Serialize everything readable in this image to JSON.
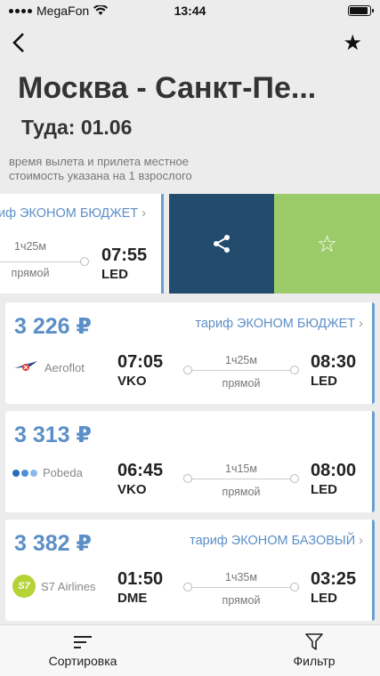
{
  "status_bar": {
    "carrier": "MegaFon",
    "time": "13:44",
    "battery_level": 0.9
  },
  "header": {
    "title": "Москва - Санкт-Пе...",
    "subtitle": "Туда: 01.06",
    "note_line1": "время вылета и прилета местное",
    "note_line2": "стоимость указана на 1 взрослого"
  },
  "swiped_card": {
    "tariff": "иф ЭКОНОМ БЮДЖЕТ",
    "duration": "1ч25м",
    "direct": "прямой",
    "arr_time": "07:55",
    "arr_code": "LED",
    "actions": {
      "share_icon": "share-icon",
      "favorite_icon": "star-outline-icon"
    }
  },
  "flights": [
    {
      "price": "3 226 ₽",
      "tariff": "тариф ЭКОНОМ БЮДЖЕТ",
      "airline": "Aeroflot",
      "dep_time": "07:05",
      "dep_code": "VKO",
      "duration": "1ч25м",
      "direct": "прямой",
      "arr_time": "08:30",
      "arr_code": "LED"
    },
    {
      "price": "3 313 ₽",
      "tariff": "",
      "airline": "Pobeda",
      "dep_time": "06:45",
      "dep_code": "VKO",
      "duration": "1ч15м",
      "direct": "прямой",
      "arr_time": "08:00",
      "arr_code": "LED"
    },
    {
      "price": "3 382 ₽",
      "tariff": "тариф ЭКОНОМ БАЗОВЫЙ",
      "airline": "S7 Airlines",
      "dep_time": "01:50",
      "dep_code": "DME",
      "duration": "1ч35м",
      "direct": "прямой",
      "arr_time": "03:25",
      "arr_code": "LED",
      "logo_text": "S7"
    }
  ],
  "bottom_bar": {
    "sort_label": "Сортировка",
    "filter_label": "Фильтр"
  },
  "colors": {
    "accent": "#5b8fc7",
    "share_bg": "#234b6e",
    "favorite_bg": "#9ccc6a"
  }
}
